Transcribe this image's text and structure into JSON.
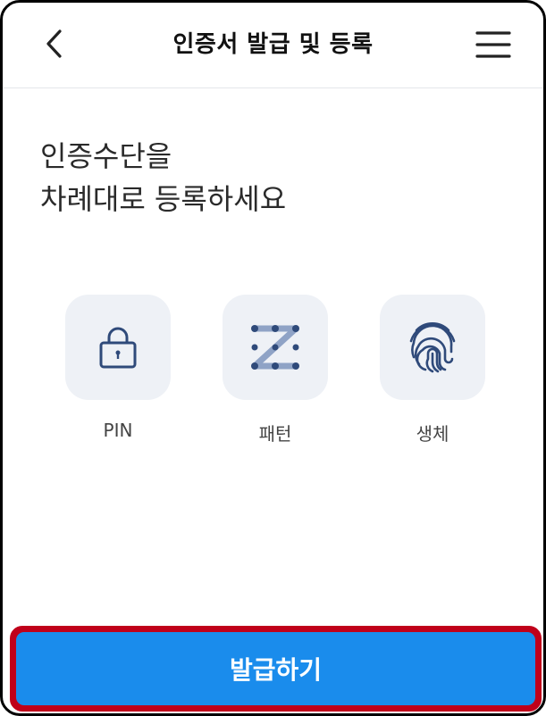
{
  "header": {
    "title": "인증서 발급 및 등록",
    "back_icon": "chevron-left-icon",
    "menu_icon": "hamburger-menu-icon"
  },
  "heading": {
    "line1": "인증수단을",
    "line2": "차례대로 등록하세요"
  },
  "methods": [
    {
      "label": "PIN",
      "icon": "lock-icon"
    },
    {
      "label": "패턴",
      "icon": "pattern-icon"
    },
    {
      "label": "생체",
      "icon": "fingerprint-icon"
    }
  ],
  "cta": {
    "label": "발급하기"
  },
  "colors": {
    "accent": "#1a8cec",
    "icon": "#2f4a7a",
    "tile_bg": "#eef1f6",
    "highlight_border": "#c0001a"
  }
}
